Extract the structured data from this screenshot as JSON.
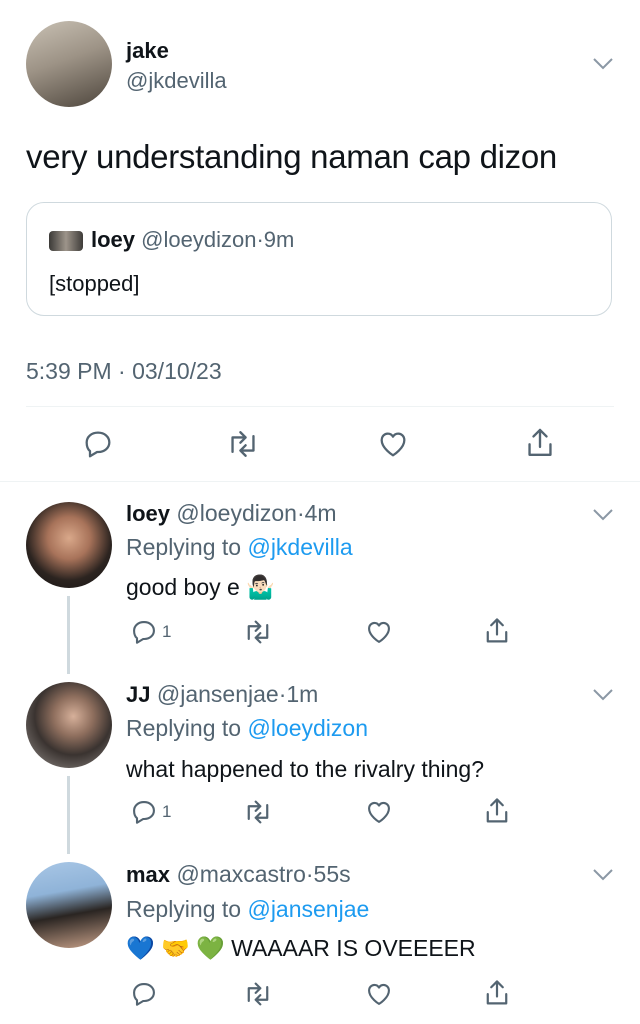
{
  "main_tweet": {
    "display_name": "jake",
    "handle": "@jkdevilla",
    "text": "very understanding naman cap dizon",
    "quoted": {
      "display_name": "loey",
      "handle": "@loeydizon",
      "sep": "·",
      "time": "9m",
      "text": "[stopped]"
    },
    "timestamp": "5:39 PM · 03/10/23"
  },
  "replies": [
    {
      "display_name": "loey",
      "handle": "@loeydizon",
      "sep": "·",
      "time": "4m",
      "replying_label": "Replying to",
      "replying_to": "@jkdevilla",
      "text": "good boy e",
      "emoji": "🤷🏻‍♂️",
      "reply_count": "1"
    },
    {
      "display_name": "JJ",
      "handle": "@jansenjae",
      "sep": "·",
      "time": "1m",
      "replying_label": "Replying to",
      "replying_to": "@loeydizon",
      "text": "what happened to the rivalry thing?",
      "reply_count": "1"
    },
    {
      "display_name": "max",
      "handle": "@maxcastro",
      "sep": "·",
      "time": "55s",
      "replying_label": "Replying to",
      "replying_to": "@jansenjae",
      "emoji1": "💙",
      "emoji2": "🤝",
      "emoji3": "💚",
      "text": "WAAAAR IS OVEEEER"
    }
  ],
  "colors": {
    "accent": "#1d9bf0",
    "muted": "#536471",
    "text": "#0f1419",
    "divider": "#eff3f4",
    "thread_line": "#cfd9de"
  },
  "icons": [
    "chevron-down-icon",
    "reply-icon",
    "retweet-icon",
    "like-icon",
    "share-icon"
  ]
}
